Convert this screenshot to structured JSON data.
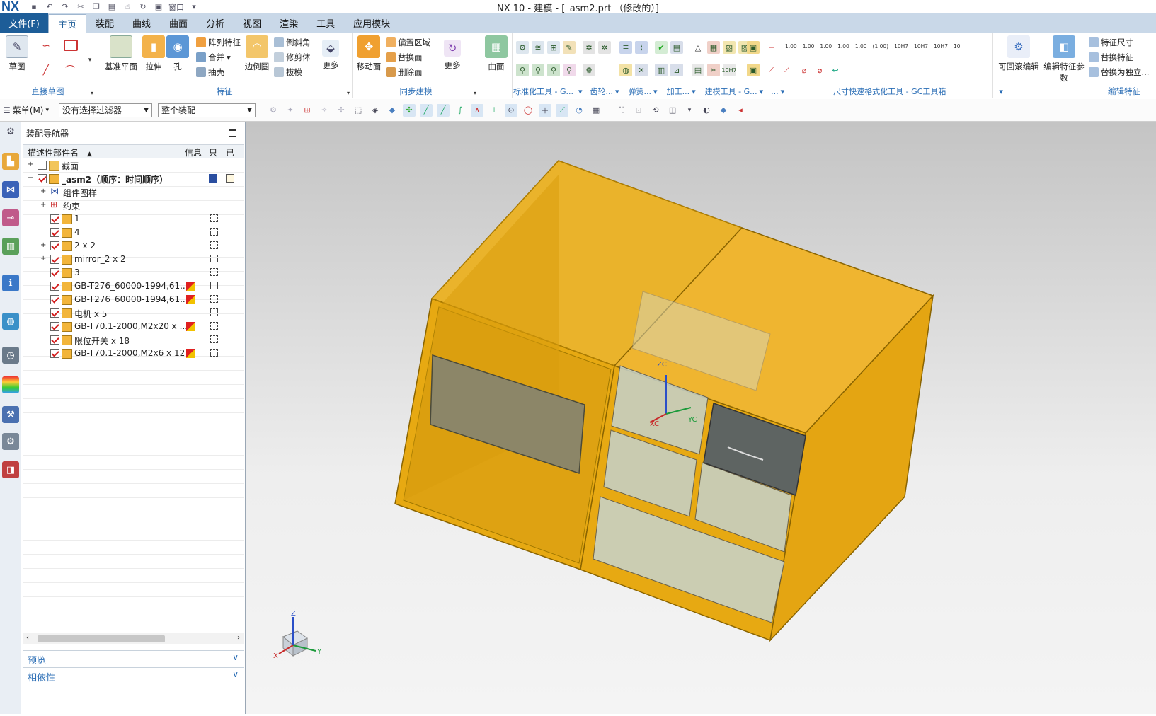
{
  "titlebar": {
    "logo": "NX",
    "title": "NX 10 - 建模 - [_asm2.prt  （修改的）]",
    "window_label": "窗口"
  },
  "tabs": {
    "file": "文件(F)",
    "items": [
      "主页",
      "装配",
      "曲线",
      "曲面",
      "分析",
      "视图",
      "渲染",
      "工具",
      "应用模块"
    ]
  },
  "ribbon": {
    "g1": {
      "label": "直接草图",
      "sketch": "草图"
    },
    "g2": {
      "label": "特征",
      "datum": "基准平面",
      "extrude": "拉伸",
      "hole": "孔",
      "pattern": "阵列特征",
      "unite": "合并",
      "shell": "抽壳",
      "edge_blend": "边倒圆",
      "chamfer": "倒斜角",
      "trim": "修剪体",
      "draft": "拔模",
      "more": "更多"
    },
    "g3": {
      "label": "同步建模",
      "move": "移动面",
      "offset": "偏置区域",
      "replace": "替换面",
      "delete": "删除面",
      "more": "更多"
    },
    "g4": {
      "label": "曲面",
      "surface": "曲面"
    },
    "g5": {
      "label": "标准化工具 - G...",
      "gear": "齿轮...",
      "spring": "弹簧...",
      "machining": "加工...",
      "model_tools": "建模工具 - G...",
      "fmt": "尺寸快速格式化工具 - GC工具箱",
      "more_short": "..."
    },
    "g6": {
      "label": "编辑特征",
      "rollback": "可回滚编辑",
      "edit_param": "编辑特征参数",
      "feat_dim": "特征尺寸",
      "replace_feat": "替换特征",
      "to_independent": "替换为独立..."
    },
    "fmt_labels": [
      "1.00",
      "1.00",
      "1.00",
      "1.00",
      "1.00",
      "(1.00)",
      "10H7",
      "10H7",
      "10H7",
      "10"
    ]
  },
  "toolbar2": {
    "menu": "菜单(M)",
    "filter": "没有选择过滤器",
    "scope": "整个装配"
  },
  "navigator": {
    "title": "装配导航器",
    "columns": {
      "name": "描述性部件名",
      "info": "信息",
      "ro": "只",
      "mod": "已"
    },
    "rows": [
      {
        "label": "截面",
        "checked": false
      },
      {
        "label": "_asm2（顺序：时间顺序）",
        "checked": true
      },
      {
        "label": "组件图样"
      },
      {
        "label": "约束"
      },
      {
        "label": "1",
        "checked": true
      },
      {
        "label": "4",
        "checked": true
      },
      {
        "label": "2 x 2",
        "checked": true
      },
      {
        "label": "mirror_2 x 2",
        "checked": true
      },
      {
        "label": "3",
        "checked": true
      },
      {
        "label": "GB-T276_60000-1994,61...",
        "checked": true
      },
      {
        "label": "GB-T276_60000-1994,61...",
        "checked": true
      },
      {
        "label": "电机 x 5",
        "checked": true
      },
      {
        "label": "GB-T70.1-2000,M2x20 x ...",
        "checked": true
      },
      {
        "label": "限位开关 x 18",
        "checked": true
      },
      {
        "label": "GB-T70.1-2000,M2x6 x 12",
        "checked": true
      }
    ],
    "preview": "预览",
    "dependency": "相依性"
  },
  "viewport": {
    "wcs": {
      "zc": "ZC",
      "yc": "YC",
      "xc": "XC"
    },
    "triad": {
      "z": "Z",
      "y": "Y",
      "x": "X"
    }
  },
  "colors": {
    "file_tab": "#1d5d98",
    "tabbar": "#c9d8e8",
    "ribbon_label": "#2a6db5",
    "model_orange": "#e6a200",
    "check_red": "#d21c1c"
  }
}
